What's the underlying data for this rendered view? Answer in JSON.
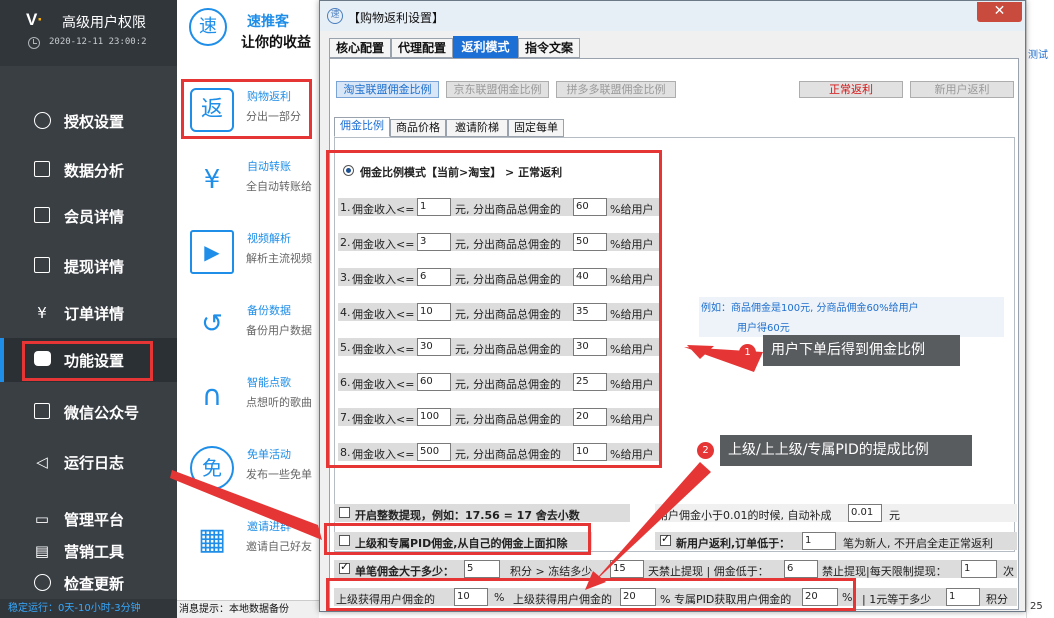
{
  "app": {
    "title": "高级用户权限",
    "time": "2020-12-11 23:00:2",
    "logo": "V"
  },
  "sidebar": {
    "items": [
      {
        "label": "授权设置",
        "icon": "globe-icon"
      },
      {
        "label": "数据分析",
        "icon": "chart-icon"
      },
      {
        "label": "会员详情",
        "icon": "edit-icon"
      },
      {
        "label": "提现详情",
        "icon": "search-doc-icon"
      },
      {
        "label": "订单详情",
        "icon": "yen-doc-icon"
      },
      {
        "label": "功能设置",
        "icon": "wechat-icon"
      },
      {
        "label": "微信公众号",
        "icon": "media-icon"
      },
      {
        "label": "运行日志",
        "icon": "speaker-icon"
      },
      {
        "label": "管理平台",
        "icon": "monitor-icon"
      },
      {
        "label": "营销工具",
        "icon": "chart-bar-icon"
      },
      {
        "label": "检查更新",
        "icon": "refresh-icon"
      }
    ],
    "status": "稳定运行：0天-10小时-3分钟"
  },
  "mid": {
    "brand_icon": "速",
    "brand_name": "速推客",
    "slogan": "让你的收益",
    "features": [
      {
        "title": "购物返利",
        "desc": "分出一部分",
        "glyph": "返"
      },
      {
        "title": "自动转账",
        "desc": "全自动转账给",
        "glyph": "¥"
      },
      {
        "title": "视频解析",
        "desc": "解析主流视频",
        "glyph": "▶"
      },
      {
        "title": "备份数据",
        "desc": "备份用户数据",
        "glyph": "↺"
      },
      {
        "title": "智能点歌",
        "desc": "点想听的歌曲",
        "glyph": "∩"
      },
      {
        "title": "免单活动",
        "desc": "发布一些免单",
        "glyph": "免"
      },
      {
        "title": "邀请进群",
        "desc": "邀请自己好友",
        "glyph": "▦"
      }
    ],
    "status_line": "消息提示：本地数据备份"
  },
  "dialog": {
    "title": "【购物返利设置】",
    "close": "✕",
    "tabs": [
      "核心配置",
      "代理配置",
      "返利模式",
      "指令文案"
    ],
    "platforms": [
      "淘宝联盟佣金比例",
      "京东联盟佣金比例",
      "拼多多联盟佣金比例"
    ],
    "modes": [
      "正常返利",
      "新用户返利"
    ],
    "subtabs": [
      "佣金比例",
      "商品价格",
      "邀请阶梯",
      "固定每单"
    ],
    "mode_label": "佣金比例模式【当前>淘宝】 > 正常返利",
    "rules": [
      {
        "n": "1.",
        "income": "1",
        "pct": "60"
      },
      {
        "n": "2.",
        "income": "3",
        "pct": "50"
      },
      {
        "n": "3.",
        "income": "6",
        "pct": "40"
      },
      {
        "n": "4.",
        "income": "10",
        "pct": "35"
      },
      {
        "n": "5.",
        "income": "30",
        "pct": "30"
      },
      {
        "n": "6.",
        "income": "60",
        "pct": "25"
      },
      {
        "n": "7.",
        "income": "100",
        "pct": "20"
      },
      {
        "n": "8.",
        "income": "500",
        "pct": "10"
      }
    ],
    "rule_text": {
      "a": "佣金收入<=",
      "b": "元, 分出商品总佣金的",
      "c": "%给用户"
    },
    "example": {
      "line1": "例如：商品佣金是100元, 分商品佣金60%给用户",
      "line2": "用户得60元"
    },
    "options": {
      "int_withdraw": "开启整数提现，例如：17.56 = 17 舍去小数",
      "min_comm_a": "用户佣金小于0.01的时候, 自动补成",
      "min_comm_value": "0.01",
      "min_comm_b": "元",
      "pid_deduct": "上级和专属PID佣金,从自己的佣金上面扣除",
      "new_user_a": "新用户返利,订单低于：",
      "new_user_value": "1",
      "new_user_b": "笔为新人, 不开启全走正常返利",
      "big_a": "单笔佣金大于多少：",
      "big_value": "5",
      "freeze_a": "积分 > 冻结多少",
      "freeze_value": "15",
      "ban_a": "天禁止提现 | 佣金低于：",
      "ban_value": "6",
      "ban_b": "禁止提现|每天限制提现：",
      "limit_value": "1",
      "limit_b": "次",
      "l1_a": "上级获得用户佣金的",
      "l1_value": "10",
      "pct": "%",
      "l2_a": "上级获得用户佣金的",
      "l2_value": "20",
      "pid_a": "% 专属PID获取用户佣金的",
      "pid_value": "20",
      "yuan_a": "| 1元等于多少",
      "yuan_value": "1",
      "yuan_b": "积分"
    }
  },
  "annotations": {
    "c1_num": "1",
    "c1_text": "用户下单后得到佣金比例",
    "c2_num": "2",
    "c2_text": "上级/上上级/专属PID的提成比例"
  },
  "right": {
    "link": "测试",
    "num": "25"
  },
  "colors": {
    "accent": "#1e8ee8",
    "highlight": "#e53535",
    "sidebar": "#3a3f44"
  }
}
